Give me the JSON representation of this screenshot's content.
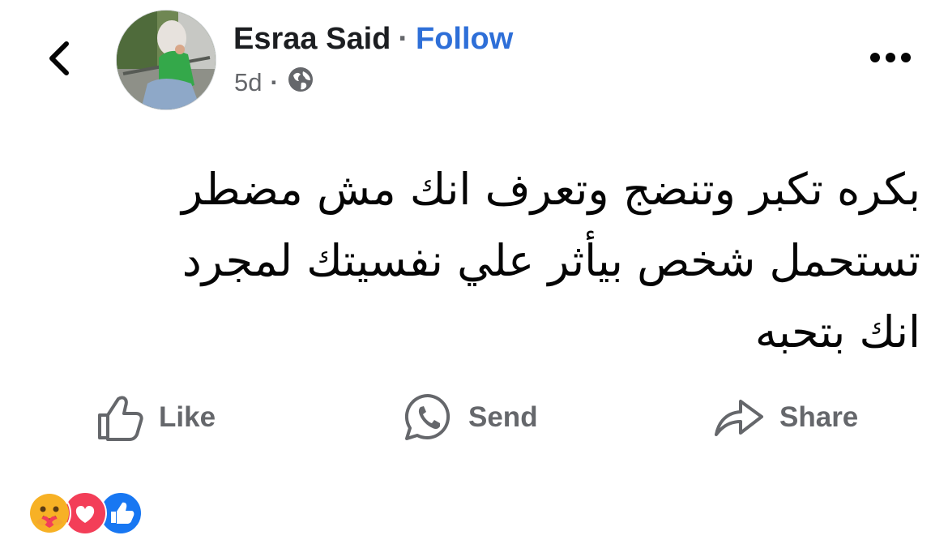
{
  "header": {
    "author_name": "Esraa Said",
    "separator": "·",
    "follow_label": "Follow",
    "timestamp": "5d",
    "meta_separator": "·",
    "audience_icon": "globe-icon"
  },
  "post": {
    "text": "بكره تكبر وتنضج وتعرف انك مش مضطر\nتستحمل شخص بيأثر علي نفسيتك لمجرد\nانك بتحبه"
  },
  "actions": {
    "like_label": "Like",
    "send_label": "Send",
    "share_label": "Share"
  },
  "reactions": [
    "care",
    "love",
    "like"
  ],
  "colors": {
    "follow": "#2e6fd8",
    "secondary_text": "#65676b",
    "love": "#f33e58",
    "like": "#1877f2",
    "care": "#f7b125"
  }
}
